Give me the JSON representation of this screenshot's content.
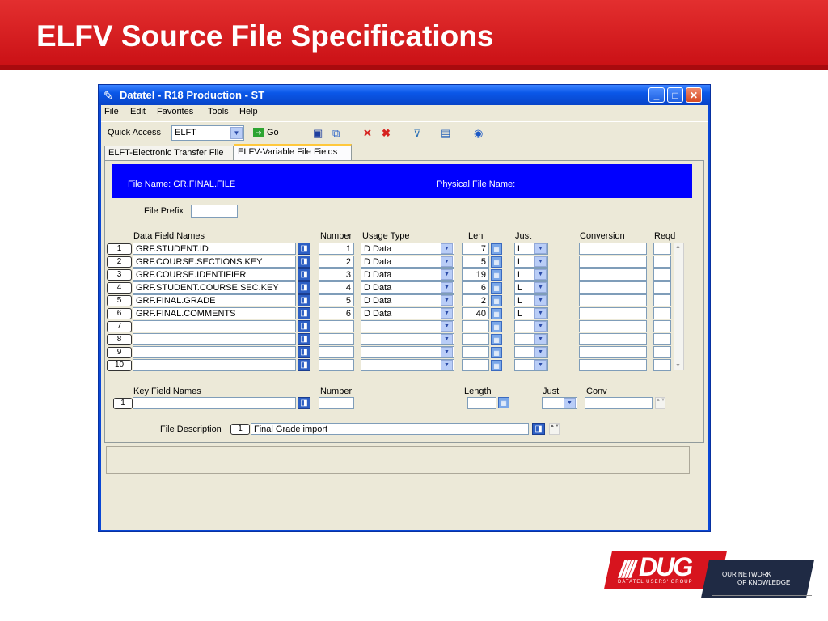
{
  "slide": {
    "title": "ELFV Source File Specifications"
  },
  "window": {
    "title": "Datatel - R18 Production - ST",
    "menu": [
      "File",
      "Edit",
      "Favorites",
      "Tools",
      "Help"
    ],
    "quick_access": {
      "label": "Quick Access",
      "value": "ELFT",
      "go_label": "Go"
    },
    "tabs": [
      "ELFT-Electronic Transfer File",
      "ELFV-Variable File Fields"
    ]
  },
  "form": {
    "file_name_label": "File Name: GR.FINAL.FILE",
    "physical_file_label": "Physical File Name:",
    "file_prefix_label": "File Prefix",
    "headers": {
      "data_field_names": "Data Field Names",
      "number": "Number",
      "usage_type": "Usage Type",
      "len": "Len",
      "just": "Just",
      "conversion": "Conversion",
      "reqd": "Reqd"
    },
    "rows": [
      {
        "idx": "1",
        "name": "GRF.STUDENT.ID",
        "number": "1",
        "usage": "D Data",
        "len": "7",
        "just": "L"
      },
      {
        "idx": "2",
        "name": "GRF.COURSE.SECTIONS.KEY",
        "number": "2",
        "usage": "D Data",
        "len": "5",
        "just": "L"
      },
      {
        "idx": "3",
        "name": "GRF.COURSE.IDENTIFIER",
        "number": "3",
        "usage": "D Data",
        "len": "19",
        "just": "L"
      },
      {
        "idx": "4",
        "name": "GRF.STUDENT.COURSE.SEC.KEY",
        "number": "4",
        "usage": "D Data",
        "len": "6",
        "just": "L"
      },
      {
        "idx": "5",
        "name": "GRF.FINAL.GRADE",
        "number": "5",
        "usage": "D Data",
        "len": "2",
        "just": "L"
      },
      {
        "idx": "6",
        "name": "GRF.FINAL.COMMENTS",
        "number": "6",
        "usage": "D Data",
        "len": "40",
        "just": "L"
      },
      {
        "idx": "7",
        "name": "",
        "number": "",
        "usage": "",
        "len": "",
        "just": ""
      },
      {
        "idx": "8",
        "name": "",
        "number": "",
        "usage": "",
        "len": "",
        "just": ""
      },
      {
        "idx": "9",
        "name": "",
        "number": "",
        "usage": "",
        "len": "",
        "just": ""
      },
      {
        "idx": "10",
        "name": "",
        "number": "",
        "usage": "",
        "len": "",
        "just": ""
      }
    ],
    "key_headers": {
      "key_field_names": "Key Field Names",
      "number": "Number",
      "length": "Length",
      "just": "Just",
      "conv": "Conv"
    },
    "key_idx": "1",
    "file_description_label": "File Description",
    "file_description_idx": "1",
    "file_description_value": "Final Grade import"
  },
  "logo": {
    "brand": "DUG",
    "bars": "////",
    "subtitle": "DATATEL USERS' GROUP",
    "tag_line1": "OUR NETWORK",
    "tag_line2": "OF KNOWLEDGE"
  }
}
